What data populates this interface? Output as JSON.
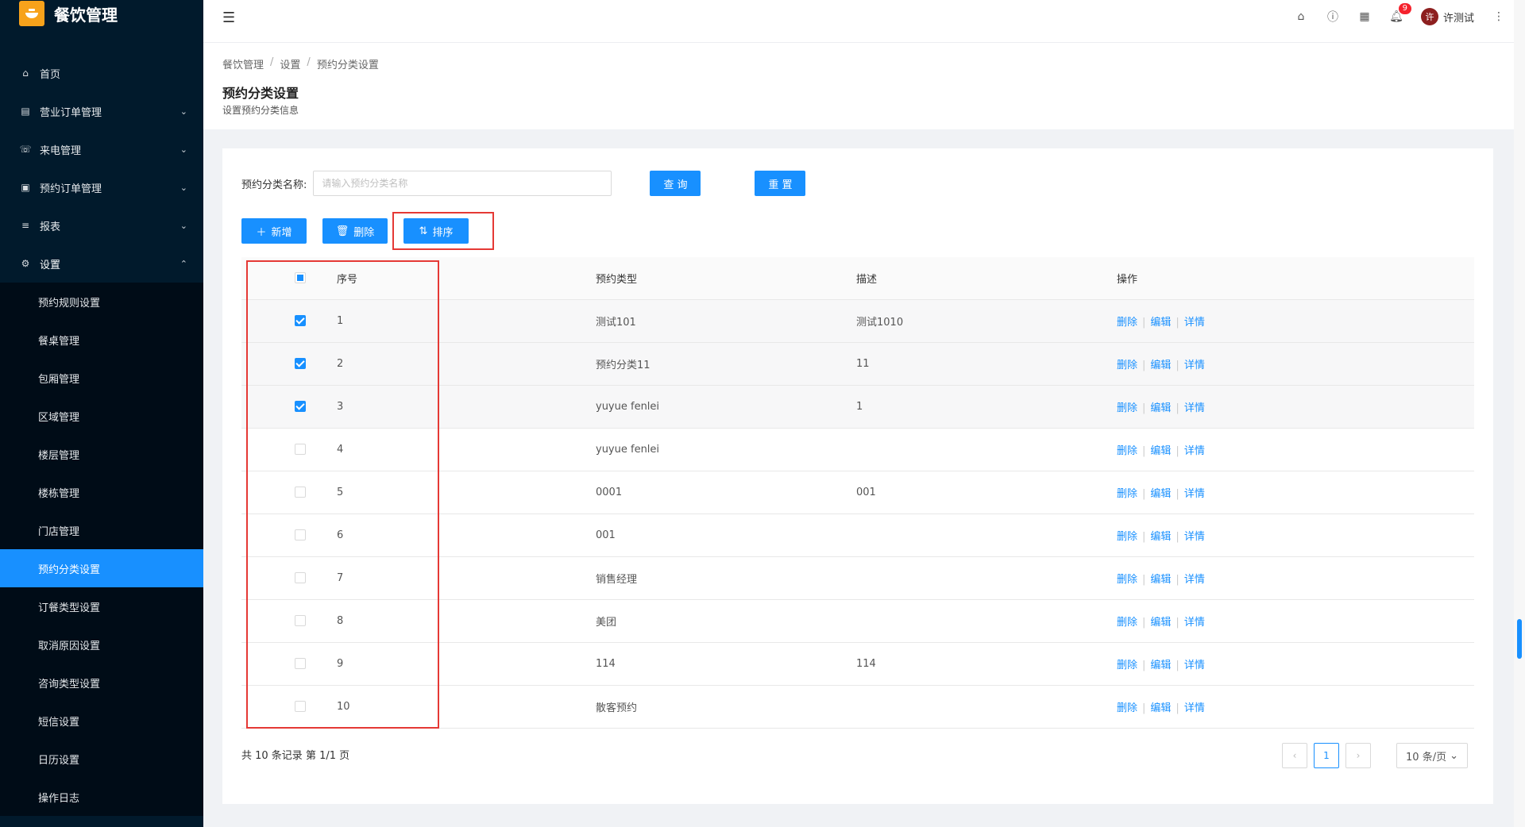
{
  "app": {
    "title": "餐饮管理"
  },
  "sidebar": {
    "items": [
      {
        "label": "首页",
        "icon": "home-icon"
      },
      {
        "label": "营业订单管理",
        "icon": "order-icon"
      },
      {
        "label": "来电管理",
        "icon": "phone-icon"
      },
      {
        "label": "预约订单管理",
        "icon": "calendar-icon"
      },
      {
        "label": "报表",
        "icon": "report-icon"
      },
      {
        "label": "设置",
        "icon": "gear-icon"
      }
    ],
    "settings_children": [
      "预约规则设置",
      "餐桌管理",
      "包厢管理",
      "区域管理",
      "楼层管理",
      "楼栋管理",
      "门店管理",
      "预约分类设置",
      "订餐类型设置",
      "取消原因设置",
      "咨询类型设置",
      "短信设置",
      "日历设置",
      "操作日志"
    ],
    "selected": "预约分类设置"
  },
  "header": {
    "notification_count": "9",
    "user_name": "许测试",
    "avatar_text": "许"
  },
  "page": {
    "breadcrumb": [
      "餐饮管理",
      "设置",
      "预约分类设置"
    ],
    "title": "预约分类设置",
    "subtitle": "设置预约分类信息"
  },
  "search": {
    "label": "预约分类名称:",
    "placeholder": "请输入预约分类名称",
    "value": "",
    "query_label": "查 询",
    "reset_label": "重 置"
  },
  "toolbar": {
    "add_label": "新增",
    "delete_label": "删除",
    "sort_label": "排序"
  },
  "table": {
    "columns": [
      "序号",
      "预约类型",
      "描述",
      "操作"
    ],
    "rows": [
      {
        "seq": "1",
        "type": "测试101",
        "desc": "测试1010",
        "checked": true
      },
      {
        "seq": "2",
        "type": "预约分类11",
        "desc": "11",
        "checked": true
      },
      {
        "seq": "3",
        "type": "yuyue fenlei",
        "desc": "1",
        "checked": true
      },
      {
        "seq": "4",
        "type": "yuyue fenlei",
        "desc": "",
        "checked": false
      },
      {
        "seq": "5",
        "type": "0001",
        "desc": "001",
        "checked": false
      },
      {
        "seq": "6",
        "type": "001",
        "desc": "",
        "checked": false
      },
      {
        "seq": "7",
        "type": "销售经理",
        "desc": "",
        "checked": false
      },
      {
        "seq": "8",
        "type": "美团",
        "desc": "",
        "checked": false
      },
      {
        "seq": "9",
        "type": "114",
        "desc": "114",
        "checked": false
      },
      {
        "seq": "10",
        "type": "散客预约",
        "desc": "",
        "checked": false
      }
    ],
    "actions": [
      "删除",
      "编辑",
      "详情"
    ]
  },
  "footer": {
    "summary": "共 10 条记录 第 1/1 页",
    "current_page": "1",
    "page_size": "10 条/页"
  },
  "colors": {
    "primary": "#1890ff",
    "sidebar_bg": "#011a2c",
    "highlight": "#e53935"
  }
}
